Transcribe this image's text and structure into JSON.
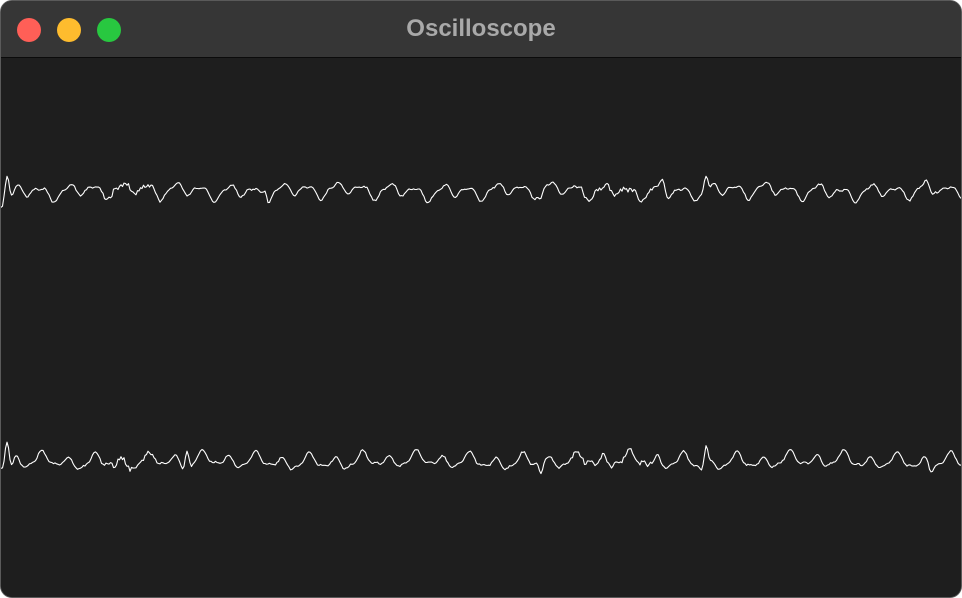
{
  "window": {
    "title": "Oscilloscope",
    "controls": {
      "close_color": "#ff5f57",
      "minimize_color": "#febc2e",
      "zoom_color": "#28c840"
    }
  },
  "scope": {
    "background_color": "#1e1e1e",
    "trace_color": "#ffffff",
    "channels": [
      {
        "id": "channel-1",
        "icon": "waveform-trace"
      },
      {
        "id": "channel-2",
        "icon": "waveform-trace"
      }
    ]
  }
}
